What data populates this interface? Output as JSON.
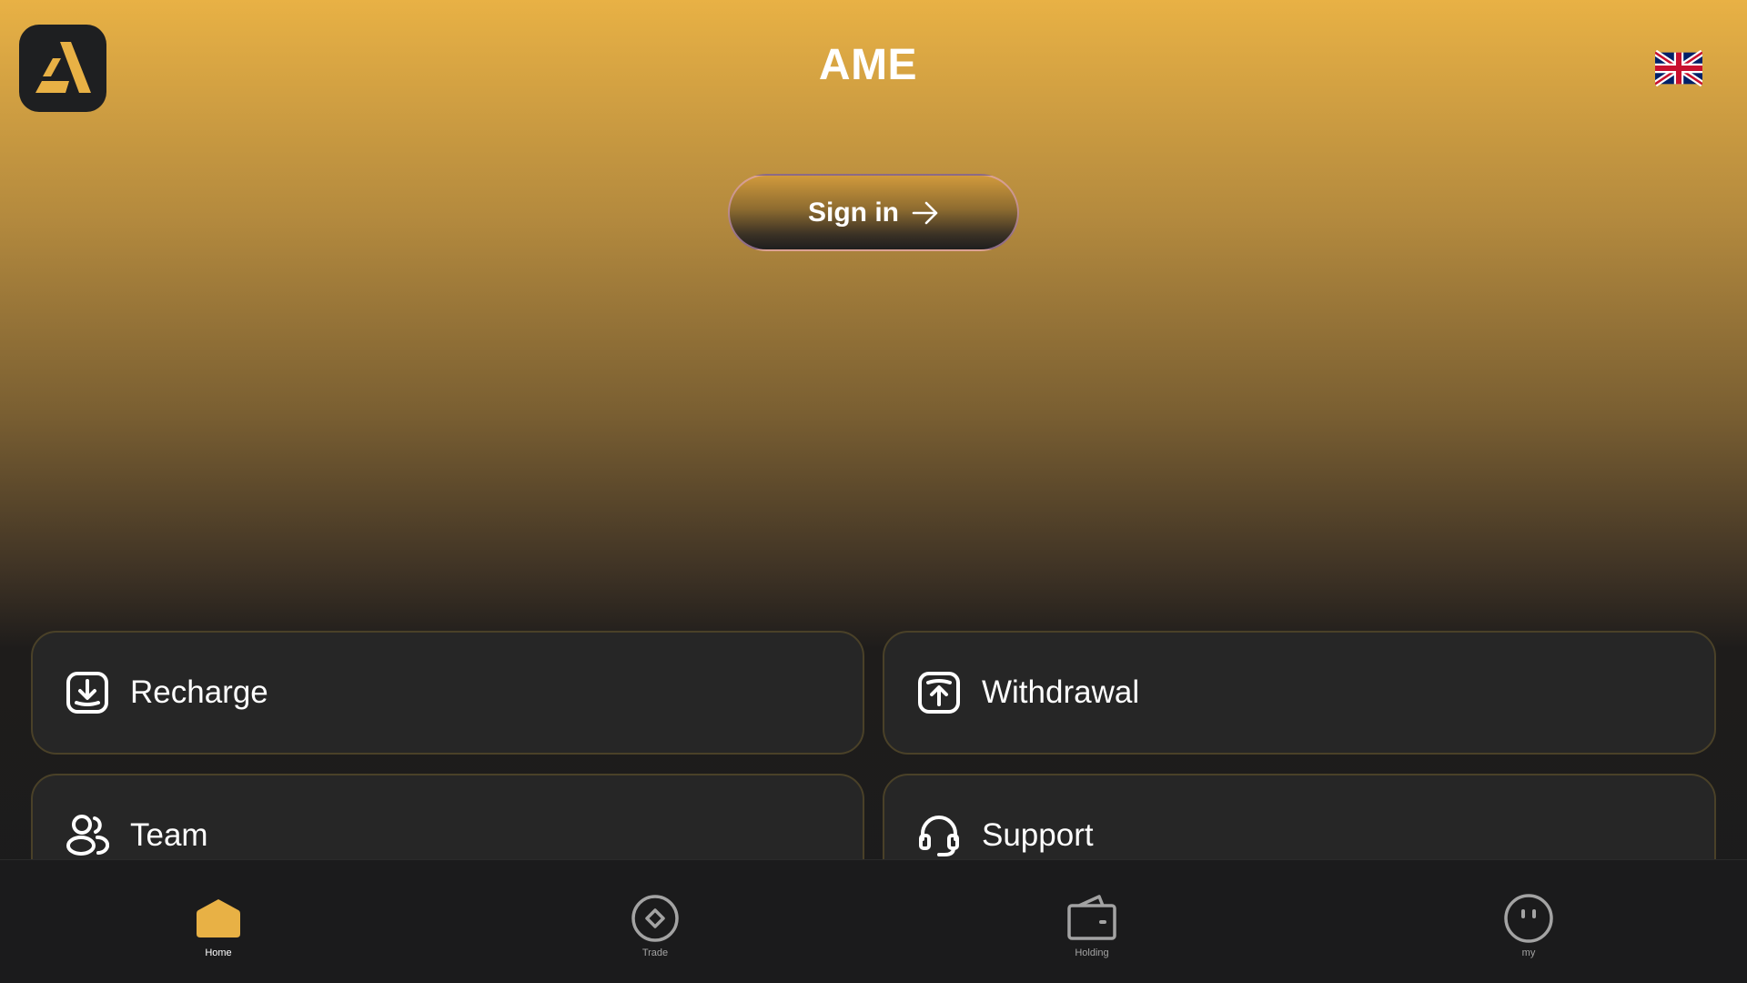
{
  "header": {
    "title": "AME",
    "logo_icon": "ame-logo",
    "language_icon": "uk-flag-icon"
  },
  "signin": {
    "label": "Sign in",
    "icon": "arrow-right-icon"
  },
  "actions": [
    {
      "label": "Recharge",
      "icon": "download-tray-icon"
    },
    {
      "label": "Withdrawal",
      "icon": "upload-tray-icon"
    },
    {
      "label": "Team",
      "icon": "users-icon"
    },
    {
      "label": "Support",
      "icon": "headset-icon"
    }
  ],
  "tabbar": {
    "items": [
      {
        "label": "Home",
        "icon": "home-icon",
        "active": true
      },
      {
        "label": "Trade",
        "icon": "trade-icon",
        "active": false
      },
      {
        "label": "Holding",
        "icon": "wallet-icon",
        "active": false
      },
      {
        "label": "my",
        "icon": "profile-face-icon",
        "active": false
      }
    ]
  },
  "colors": {
    "accent": "#e8b145",
    "card_bg": "#262626",
    "card_border": "#4a4128",
    "tabbar_bg": "#1b1b1c",
    "inactive_icon": "#a3a3a3"
  }
}
